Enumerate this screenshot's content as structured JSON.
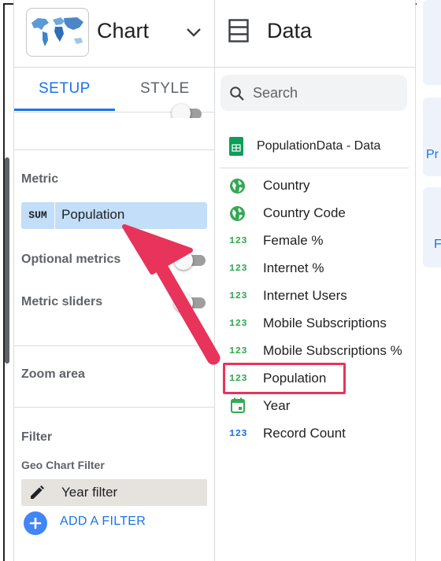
{
  "colors": {
    "accent": "#1a73e8",
    "highlight": "#e8335b",
    "metric_chip": "#c2def8",
    "filter_chip": "#e6e2de"
  },
  "chart_panel": {
    "title": "Chart",
    "tabs": [
      "SETUP",
      "STYLE"
    ],
    "active_tab": "SETUP",
    "sections": {
      "metric": {
        "label": "Metric",
        "aggregation": "SUM",
        "field": "Population"
      },
      "optional_metrics": {
        "label": "Optional metrics",
        "enabled": false
      },
      "metric_sliders": {
        "label": "Metric sliders",
        "enabled": false
      },
      "zoom_area": {
        "label": "Zoom area"
      },
      "filter": {
        "label": "Filter",
        "sublabel": "Geo Chart Filter",
        "chip": "Year filter",
        "add_label": "ADD A FILTER"
      }
    }
  },
  "data_panel": {
    "title": "Data",
    "search_placeholder": "Search",
    "source_name": "PopulationData - Data",
    "fields": [
      {
        "icon": "globe-icon",
        "label": "Country"
      },
      {
        "icon": "globe-icon",
        "label": "Country Code"
      },
      {
        "icon": "123",
        "label": "Female %"
      },
      {
        "icon": "123",
        "label": "Internet %"
      },
      {
        "icon": "123",
        "label": "Internet Users"
      },
      {
        "icon": "123",
        "label": "Mobile Subscriptions"
      },
      {
        "icon": "123",
        "label": "Mobile Subscriptions %"
      },
      {
        "icon": "123",
        "label": "Population"
      },
      {
        "icon": "calendar-icon",
        "label": "Year"
      },
      {
        "icon": "123",
        "label": "Record Count"
      }
    ],
    "highlighted_field": "Population"
  },
  "right_panel": {
    "fragments": [
      "Pr",
      "F"
    ]
  }
}
